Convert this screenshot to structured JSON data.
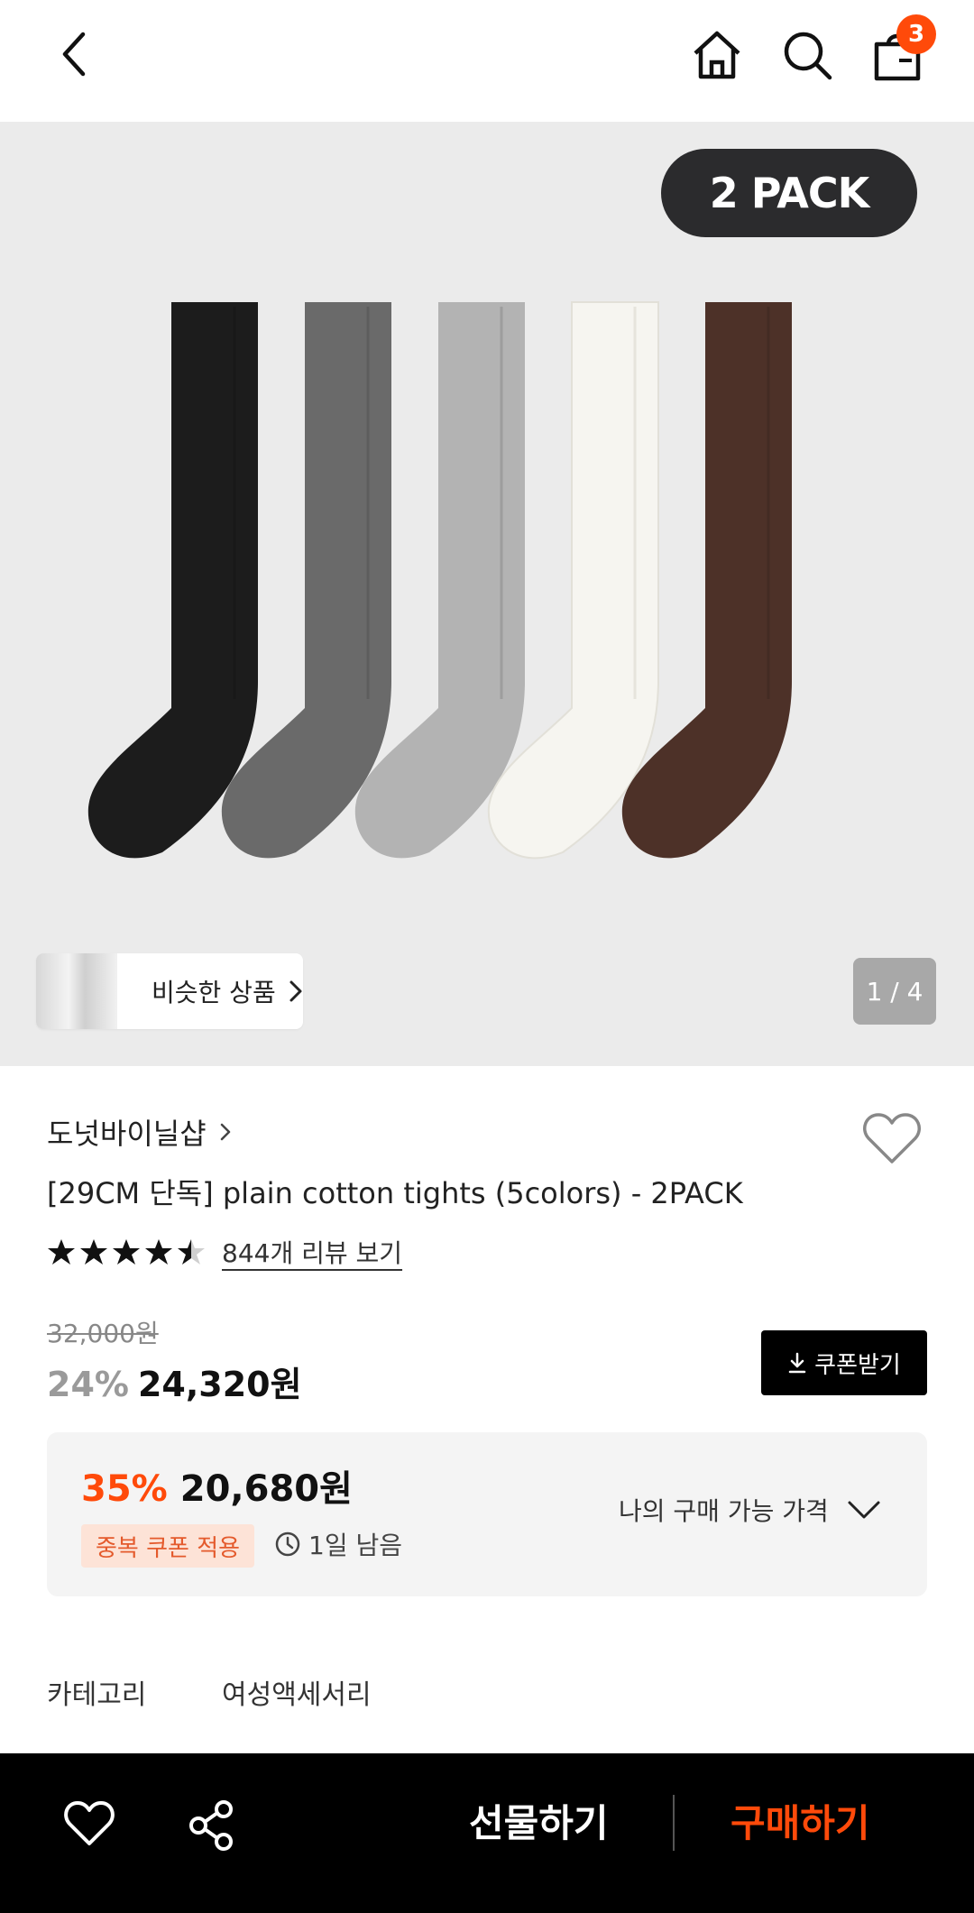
{
  "topbar": {
    "cart_count": "3"
  },
  "hero": {
    "pack_badge": "2 PACK",
    "similar_label": "비슷한 상품",
    "image_counter": "1 / 4",
    "sock_colors": [
      "#1c1c1c",
      "#6a6a6a",
      "#b3b3b3",
      "#f6f5f0",
      "#4d3128"
    ]
  },
  "product": {
    "brand": "도넛바이닐샵",
    "title": "[29CM 단독] plain cotton tights (5colors) - 2PACK",
    "rating": 4.5,
    "review_link": "844개 리뷰 보기",
    "original_price": "32,000원",
    "discount_pct": "24%",
    "sale_price": "24,320원",
    "coupon_button": "쿠폰받기"
  },
  "best_price": {
    "pct": "35%",
    "price": "20,680원",
    "badge": "중복 쿠폰 적용",
    "time_left": "1일 남음",
    "my_price_label": "나의 구매 가능 가격"
  },
  "category": {
    "label": "카테고리",
    "value": "여성액세서리"
  },
  "bottom": {
    "gift_label": "선물하기",
    "buy_label": "구매하기"
  },
  "colors": {
    "accent": "#ff4a0a",
    "bottom_bar": "#000000",
    "hero_bg": "#ebebeb"
  }
}
